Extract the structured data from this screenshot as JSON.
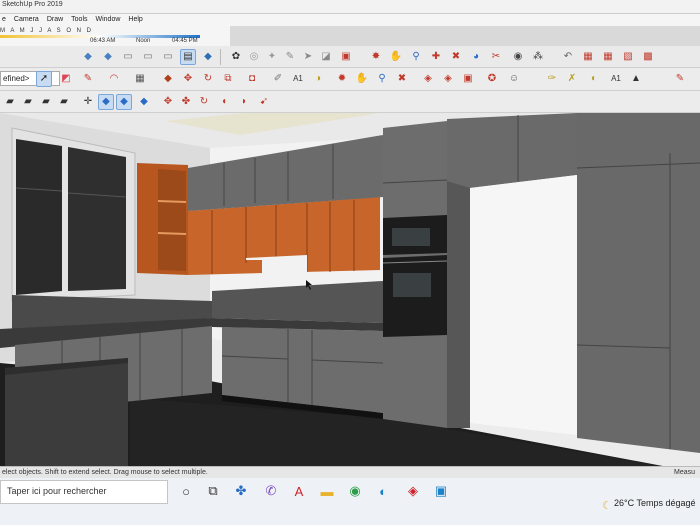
{
  "window": {
    "title": "SketchUp Pro 2019"
  },
  "menu": [
    "e",
    "Camera",
    "Draw",
    "Tools",
    "Window",
    "Help"
  ],
  "shadow": {
    "months": "M A M J J A S O N D",
    "time_start": "06:43 AM",
    "time_mid": "Noon",
    "time_end": "04:45 PM"
  },
  "toolbar": {
    "style_dropdown": "efined>"
  },
  "status": {
    "hint": "elect objects. Shift to extend select. Drag mouse to select multiple.",
    "measurements_label": "Measu"
  },
  "taskbar": {
    "search_placeholder": "Taper ici pour rechercher",
    "weather": "26°C  Temps dégagé"
  },
  "colors": {
    "cabinet_grey": "#6d6d6d",
    "wood": "#c8652a",
    "countertop": "#3a3a3a",
    "floor": "#1e1e1e",
    "selection_blue": "#c7dcf3"
  }
}
